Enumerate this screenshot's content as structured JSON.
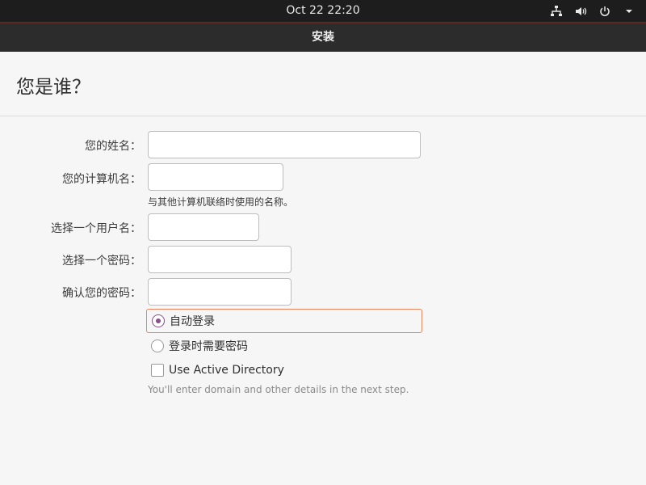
{
  "topbar": {
    "clock": "Oct 22  22:20",
    "icons": [
      "network-icon",
      "volume-icon",
      "power-icon",
      "menu-arrow-icon"
    ]
  },
  "window": {
    "title": "安装"
  },
  "page": {
    "heading": "您是谁？"
  },
  "form": {
    "name_label": "您的姓名：",
    "name_value": "",
    "computer_label": "您的计算机名：",
    "computer_value": "",
    "computer_hint": "与其他计算机联络时使用的名称。",
    "username_label": "选择一个用户名：",
    "username_value": "",
    "password_label": "选择一个密码：",
    "password_value": "",
    "confirm_label": "确认您的密码：",
    "confirm_value": "",
    "auto_login_label": "自动登录",
    "auto_login_selected": true,
    "require_password_label": "登录时需要密码",
    "require_password_selected": false,
    "active_directory_label": "Use Active Directory",
    "active_directory_checked": false,
    "active_directory_note": "You'll enter domain and other details in the next step."
  },
  "colors": {
    "accent": "#87508a",
    "focus": "#e9865e",
    "topbar": "#1d1d1d",
    "titlebar": "#2c2c2c"
  }
}
